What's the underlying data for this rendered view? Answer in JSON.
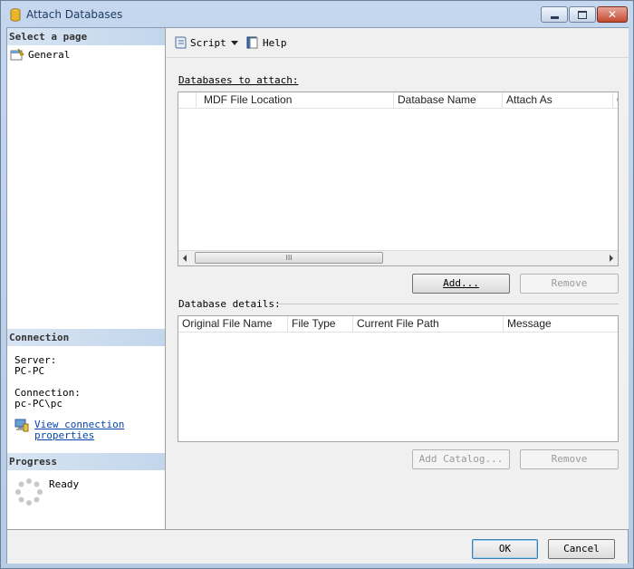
{
  "window": {
    "title": "Attach Databases"
  },
  "left": {
    "select_page_header": "Select a page",
    "pages": [
      {
        "label": "General"
      }
    ],
    "connection_header": "Connection",
    "server_label": "Server:",
    "server_value": "PC-PC",
    "connection_label": "Connection:",
    "connection_value": "pc-PC\\pc",
    "view_link_line1": "View connection",
    "view_link_line2": "properties",
    "progress_header": "Progress",
    "progress_status": "Ready"
  },
  "toolbar": {
    "script_label": "Script",
    "help_label": "Help"
  },
  "attach": {
    "group_label": "Databases to attach:",
    "columns": [
      "MDF File Location",
      "Database Name",
      "Attach As",
      "O"
    ],
    "scroll_mark": "III",
    "add_label": "Add...",
    "remove_label": "Remove"
  },
  "details": {
    "group_label": "Database details:",
    "columns": [
      "Original File Name",
      "File Type",
      "Current File Path",
      "Message"
    ],
    "add_catalog_label": "Add Catalog...",
    "remove_label": "Remove"
  },
  "footer": {
    "ok_label": "OK",
    "cancel_label": "Cancel"
  }
}
